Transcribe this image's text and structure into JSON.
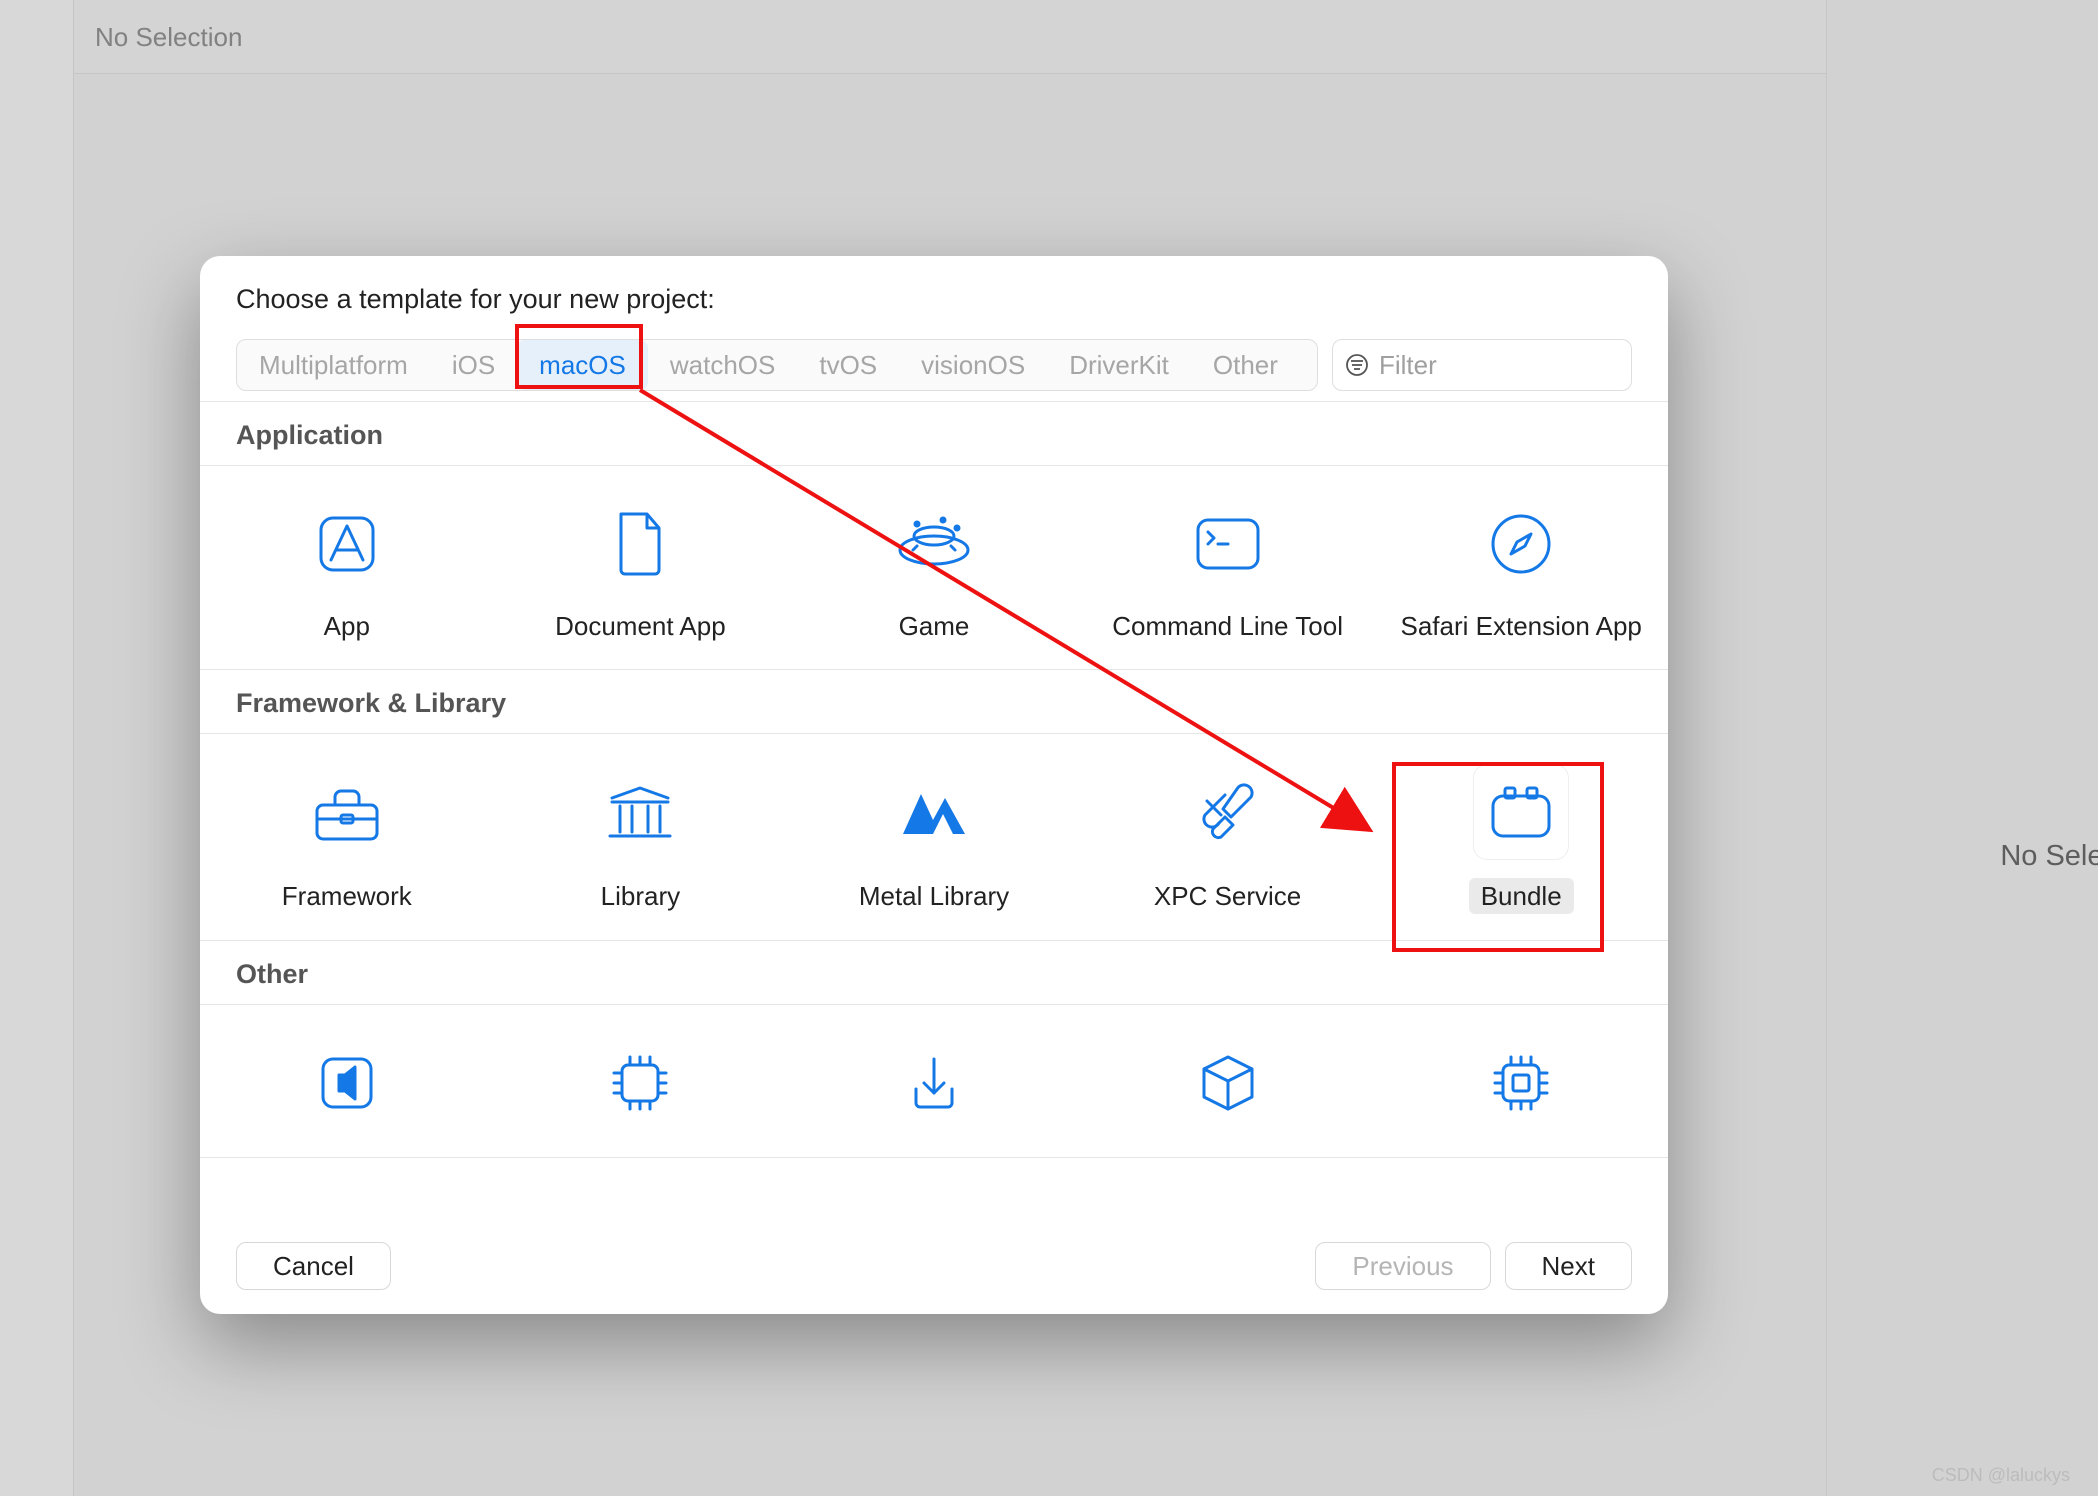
{
  "background": {
    "no_selection_left": "No Selection",
    "no_selection_right": "No Selec",
    "watermark": "CSDN @laluckys"
  },
  "modal": {
    "title": "Choose a template for your new project:",
    "tabs": [
      "Multiplatform",
      "iOS",
      "macOS",
      "watchOS",
      "tvOS",
      "visionOS",
      "DriverKit",
      "Other"
    ],
    "selected_tab": "macOS",
    "filter_placeholder": "Filter",
    "sections": [
      {
        "title": "Application",
        "items": [
          {
            "name": "App",
            "icon": "app-icon"
          },
          {
            "name": "Document App",
            "icon": "document-icon"
          },
          {
            "name": "Game",
            "icon": "game-icon"
          },
          {
            "name": "Command Line Tool",
            "icon": "terminal-icon"
          },
          {
            "name": "Safari Extension App",
            "icon": "compass-icon"
          }
        ]
      },
      {
        "title": "Framework & Library",
        "items": [
          {
            "name": "Framework",
            "icon": "toolbox-icon"
          },
          {
            "name": "Library",
            "icon": "library-icon"
          },
          {
            "name": "Metal Library",
            "icon": "metal-icon"
          },
          {
            "name": "XPC Service",
            "icon": "xpc-icon"
          },
          {
            "name": "Bundle",
            "icon": "bundle-icon",
            "selected": true
          }
        ]
      },
      {
        "title": "Other",
        "items": [
          {
            "name": "",
            "icon": "audio-mac-icon"
          },
          {
            "name": "",
            "icon": "chip-icon"
          },
          {
            "name": "",
            "icon": "download-icon"
          },
          {
            "name": "",
            "icon": "package-icon"
          },
          {
            "name": "",
            "icon": "chip2-icon"
          }
        ]
      }
    ],
    "footer": {
      "cancel": "Cancel",
      "previous": "Previous",
      "next": "Next"
    }
  },
  "annotations": {
    "highlight_tab": "macOS",
    "highlight_template": "Bundle"
  },
  "colors": {
    "accent": "#1478e6",
    "annotation": "#e11"
  }
}
